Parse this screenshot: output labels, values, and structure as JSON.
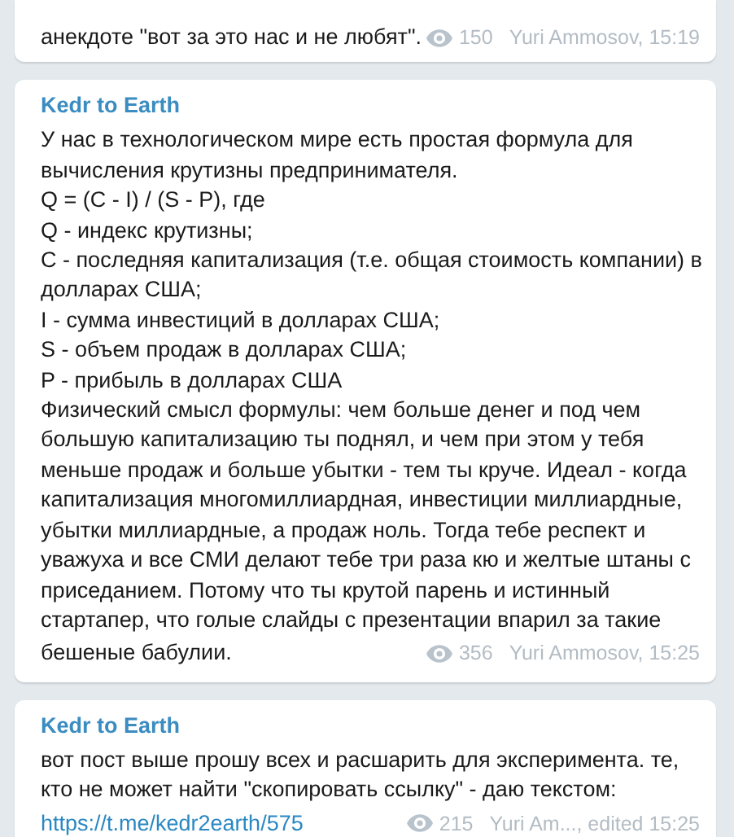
{
  "messages": [
    {
      "lines": [
        {
          "kind": "text",
          "text": "анекдоте \"вот за это нас и не любят\"."
        }
      ],
      "views": "150",
      "signature": "Yuri Ammosov, 15:19"
    },
    {
      "sender": "Kedr to Earth",
      "lines": [
        {
          "kind": "text",
          "text": "У нас в технологическом мире есть простая формула для"
        },
        {
          "kind": "text",
          "text": "вычисления крутизны предпринимателя."
        },
        {
          "kind": "text",
          "text": "Q = (C - I) / (S - P), где"
        },
        {
          "kind": "text",
          "text": "Q - индекс крутизны;"
        },
        {
          "kind": "text",
          "text": "C - последняя капитализация (т.е. общая стоимость компании) в"
        },
        {
          "kind": "text",
          "text": "долларах США;"
        },
        {
          "kind": "text",
          "text": "I - сумма инвестиций в долларах США;"
        },
        {
          "kind": "text",
          "text": "S - объем продаж в долларах США;"
        },
        {
          "kind": "text",
          "text": "P - прибыль в долларах США"
        },
        {
          "kind": "text",
          "text": "Физический смысл формулы: чем больше денег и под чем"
        },
        {
          "kind": "text",
          "text": "большую капитализацию ты поднял, и чем при этом у тебя"
        },
        {
          "kind": "text",
          "text": "меньше продаж и больше убытки - тем ты круче. Идеал - когда"
        },
        {
          "kind": "text",
          "text": "капитализация многомиллиардная, инвестиции миллиардные,"
        },
        {
          "kind": "text",
          "text": "убытки миллиардные, а продаж ноль. Тогда тебе респект и"
        },
        {
          "kind": "text",
          "text": "уважуха и все СМИ делают тебе три раза кю и желтые штаны с"
        },
        {
          "kind": "text",
          "text": "приседанием. Потому что ты крутой парень и истинный"
        },
        {
          "kind": "text",
          "text": "стартапер, что голые слайды с презентации впарил за такие"
        },
        {
          "kind": "text",
          "text": "бешеные бабулии."
        }
      ],
      "views": "356",
      "signature": "Yuri Ammosov, 15:25"
    },
    {
      "sender": "Kedr to Earth",
      "lines": [
        {
          "kind": "text",
          "text": "вот пост выше прошу всех и расшарить для эксперимента. те,"
        },
        {
          "kind": "text",
          "text": "кто не может найти \"скопировать ссылку\" - даю текстом:"
        },
        {
          "kind": "link",
          "text": "https://t.me/kedr2earth/575"
        }
      ],
      "views": "215",
      "signature": "Yuri Am..., edited 15:25"
    }
  ]
}
